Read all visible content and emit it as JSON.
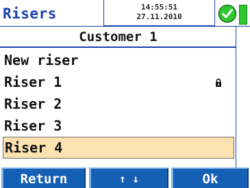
{
  "header": {
    "title": "Risers",
    "time": "14:55:51",
    "date": "27.11.2010",
    "status_icon": "check-circle-icon",
    "battery_icon": "battery-icon"
  },
  "subtitle": "Customer 1",
  "list": {
    "items": [
      {
        "label": "New riser",
        "locked": false,
        "selected": false
      },
      {
        "label": "Riser 1",
        "locked": true,
        "selected": false
      },
      {
        "label": "Riser 2",
        "locked": false,
        "selected": false
      },
      {
        "label": "Riser 3",
        "locked": false,
        "selected": false
      },
      {
        "label": "Riser 4",
        "locked": false,
        "selected": true
      }
    ]
  },
  "softkeys": {
    "return_label": "Return",
    "updown_label": "↑ ↓",
    "ok_label": "Ok"
  },
  "colors": {
    "accent": "#1a3fb0",
    "softkey_bg": "#1560b4",
    "selection_bg": "#fbe2b0",
    "ok_green": "#2ec82e"
  }
}
